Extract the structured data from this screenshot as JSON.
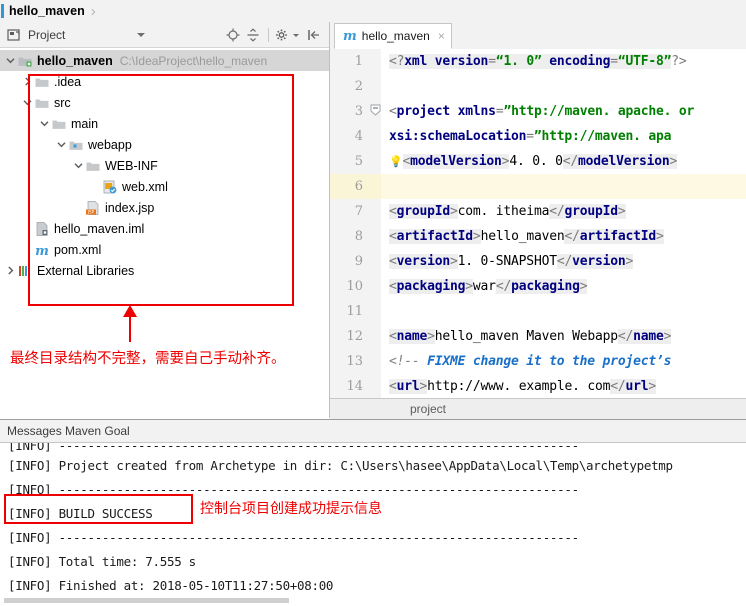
{
  "breadcrumb": {
    "project_name": "hello_maven",
    "separator": "›"
  },
  "project_panel": {
    "title": "Project",
    "icons": {
      "panel": "project-panel-icon",
      "caret": "chevron-down-icon",
      "locate": "locate-target-icon",
      "collapse_all": "collapse-all-icon",
      "settings": "gear-icon",
      "hide": "hide-panel-icon"
    },
    "tree": [
      {
        "label": "hello_maven",
        "path": "C:\\IdeaProject\\hello_maven",
        "indent": 0,
        "arrow": "expanded",
        "icon": "module-icon",
        "bold": true,
        "selected": true
      },
      {
        "label": ".idea",
        "path": "",
        "indent": 1,
        "arrow": "collapsed",
        "icon": "folder-icon",
        "bold": false,
        "selected": false
      },
      {
        "label": "src",
        "path": "",
        "indent": 1,
        "arrow": "expanded",
        "icon": "folder-icon",
        "bold": false,
        "selected": false
      },
      {
        "label": "main",
        "path": "",
        "indent": 2,
        "arrow": "expanded",
        "icon": "folder-icon",
        "bold": false,
        "selected": false
      },
      {
        "label": "webapp",
        "path": "",
        "indent": 3,
        "arrow": "expanded",
        "icon": "source-folder-icon",
        "bold": false,
        "selected": false
      },
      {
        "label": "WEB-INF",
        "path": "",
        "indent": 4,
        "arrow": "expanded",
        "icon": "folder-icon",
        "bold": false,
        "selected": false
      },
      {
        "label": "web.xml",
        "path": "",
        "indent": 5,
        "arrow": "none",
        "icon": "xml-file-icon",
        "bold": false,
        "selected": false
      },
      {
        "label": "index.jsp",
        "path": "",
        "indent": 4,
        "arrow": "none",
        "icon": "jsp-file-icon",
        "bold": false,
        "selected": false
      },
      {
        "label": "hello_maven.iml",
        "path": "",
        "indent": 1,
        "arrow": "none",
        "icon": "iml-file-icon",
        "bold": false,
        "selected": false
      },
      {
        "label": "pom.xml",
        "path": "",
        "indent": 1,
        "arrow": "none",
        "icon": "maven-pom-icon",
        "bold": false,
        "selected": false
      },
      {
        "label": "External Libraries",
        "path": "",
        "indent": 0,
        "arrow": "collapsed",
        "icon": "libraries-icon",
        "bold": false,
        "selected": false
      }
    ],
    "annotation": "最终目录结构不完整，需要自己手动补齐。"
  },
  "editor": {
    "tab": {
      "label": "hello_maven",
      "icon_letter": "m",
      "close": "×"
    },
    "status_element": "project",
    "current_line": 6,
    "lines": [
      {
        "n": 1,
        "segments": [
          {
            "t": "<?",
            "c": "br",
            "bg": true
          },
          {
            "t": "xml",
            "c": "tg",
            "bg": true
          },
          {
            "t": " ",
            "c": "tx",
            "bg": true
          },
          {
            "t": "version",
            "c": "at",
            "bg": true
          },
          {
            "t": "=",
            "c": "br",
            "bg": true
          },
          {
            "t": "“1. 0”",
            "c": "st",
            "bg": true
          },
          {
            "t": " ",
            "c": "tx",
            "bg": true
          },
          {
            "t": "encoding",
            "c": "at",
            "bg": true
          },
          {
            "t": "=",
            "c": "br",
            "bg": true
          },
          {
            "t": "“UTF-8”",
            "c": "st",
            "bg": true
          },
          {
            "t": "?>",
            "c": "br",
            "bg": false
          }
        ]
      },
      {
        "n": 2,
        "segments": []
      },
      {
        "n": 3,
        "fold": true,
        "segments": [
          {
            "t": "<",
            "c": "br",
            "bg": false
          },
          {
            "t": "project",
            "c": "tg",
            "bg": false
          },
          {
            "t": " ",
            "c": "tx",
            "bg": false
          },
          {
            "t": "xmlns",
            "c": "at",
            "bg": false
          },
          {
            "t": "=",
            "c": "br",
            "bg": false
          },
          {
            "t": "”http://maven. apache. or",
            "c": "st",
            "bg": false
          }
        ]
      },
      {
        "n": 4,
        "segments": [
          {
            "t": "  ",
            "c": "tx",
            "bg": false
          },
          {
            "t": "xsi:schemaLocation",
            "c": "at",
            "bg": false
          },
          {
            "t": "=",
            "c": "br",
            "bg": false
          },
          {
            "t": "”http://maven. apa",
            "c": "st",
            "bg": false
          }
        ]
      },
      {
        "n": 5,
        "bulb": true,
        "segments": [
          {
            "t": "<",
            "c": "br",
            "bg": true
          },
          {
            "t": "modelVersion",
            "c": "tg",
            "bg": true
          },
          {
            "t": ">",
            "c": "br",
            "bg": true
          },
          {
            "t": "4. 0. 0",
            "c": "tx",
            "bg": false
          },
          {
            "t": "</",
            "c": "br",
            "bg": true
          },
          {
            "t": "modelVersion",
            "c": "tg",
            "bg": true
          },
          {
            "t": ">",
            "c": "br",
            "bg": true
          }
        ]
      },
      {
        "n": 6,
        "segments": []
      },
      {
        "n": 7,
        "segments": [
          {
            "t": "  ",
            "c": "tx",
            "bg": false
          },
          {
            "t": "<",
            "c": "br",
            "bg": true
          },
          {
            "t": "groupId",
            "c": "tg",
            "bg": true
          },
          {
            "t": ">",
            "c": "br",
            "bg": true
          },
          {
            "t": "com. itheima",
            "c": "tx",
            "bg": false
          },
          {
            "t": "</",
            "c": "br",
            "bg": true
          },
          {
            "t": "groupId",
            "c": "tg",
            "bg": true
          },
          {
            "t": ">",
            "c": "br",
            "bg": true
          }
        ]
      },
      {
        "n": 8,
        "segments": [
          {
            "t": "  ",
            "c": "tx",
            "bg": false
          },
          {
            "t": "<",
            "c": "br",
            "bg": true
          },
          {
            "t": "artifactId",
            "c": "tg",
            "bg": true
          },
          {
            "t": ">",
            "c": "br",
            "bg": true
          },
          {
            "t": "hello_maven",
            "c": "tx",
            "bg": false
          },
          {
            "t": "</",
            "c": "br",
            "bg": true
          },
          {
            "t": "artifactId",
            "c": "tg",
            "bg": true
          },
          {
            "t": ">",
            "c": "br",
            "bg": true
          }
        ]
      },
      {
        "n": 9,
        "segments": [
          {
            "t": "  ",
            "c": "tx",
            "bg": false
          },
          {
            "t": "<",
            "c": "br",
            "bg": true
          },
          {
            "t": "version",
            "c": "tg",
            "bg": true
          },
          {
            "t": ">",
            "c": "br",
            "bg": true
          },
          {
            "t": "1. 0-SNAPSHOT",
            "c": "tx",
            "bg": false
          },
          {
            "t": "</",
            "c": "br",
            "bg": true
          },
          {
            "t": "version",
            "c": "tg",
            "bg": true
          },
          {
            "t": ">",
            "c": "br",
            "bg": true
          }
        ]
      },
      {
        "n": 10,
        "segments": [
          {
            "t": "  ",
            "c": "tx",
            "bg": false
          },
          {
            "t": "<",
            "c": "br",
            "bg": true
          },
          {
            "t": "packaging",
            "c": "tg",
            "bg": true
          },
          {
            "t": ">",
            "c": "br",
            "bg": true
          },
          {
            "t": "war",
            "c": "tx",
            "bg": false
          },
          {
            "t": "</",
            "c": "br",
            "bg": true
          },
          {
            "t": "packaging",
            "c": "tg",
            "bg": true
          },
          {
            "t": ">",
            "c": "br",
            "bg": true
          }
        ]
      },
      {
        "n": 11,
        "segments": []
      },
      {
        "n": 12,
        "segments": [
          {
            "t": "  ",
            "c": "tx",
            "bg": false
          },
          {
            "t": "<",
            "c": "br",
            "bg": true
          },
          {
            "t": "name",
            "c": "tg",
            "bg": true
          },
          {
            "t": ">",
            "c": "br",
            "bg": true
          },
          {
            "t": "hello_maven Maven Webapp",
            "c": "tx",
            "bg": false
          },
          {
            "t": "</",
            "c": "br",
            "bg": true
          },
          {
            "t": "name",
            "c": "tg",
            "bg": true
          },
          {
            "t": ">",
            "c": "br",
            "bg": true
          }
        ]
      },
      {
        "n": 13,
        "segments": [
          {
            "t": "  ",
            "c": "tx",
            "bg": false
          },
          {
            "t": "<!-- ",
            "c": "cm",
            "bg": false
          },
          {
            "t": "FIXME",
            "c": "fixme",
            "bg": false
          },
          {
            "t": " change it to the project’s",
            "c": "fixme",
            "bg": false
          }
        ]
      },
      {
        "n": 14,
        "segments": [
          {
            "t": "  ",
            "c": "tx",
            "bg": false
          },
          {
            "t": "<",
            "c": "br",
            "bg": true
          },
          {
            "t": "url",
            "c": "tg",
            "bg": true
          },
          {
            "t": ">",
            "c": "br",
            "bg": true
          },
          {
            "t": "http://www. example. com",
            "c": "tx",
            "bg": false
          },
          {
            "t": "</",
            "c": "br",
            "bg": true
          },
          {
            "t": "url",
            "c": "tg",
            "bg": true
          },
          {
            "t": ">",
            "c": "br",
            "bg": true
          }
        ]
      }
    ]
  },
  "console": {
    "title": "Messages Maven Goal",
    "lines": [
      {
        "text": "[INFO] ------------------------------------------------------------------------",
        "clip": true
      },
      {
        "text": "[INFO] Project created from Archetype in dir: C:\\Users\\hasee\\AppData\\Local\\Temp\\archetypetmp",
        "clip": false
      },
      {
        "text": "[INFO] ------------------------------------------------------------------------",
        "clip": false
      },
      {
        "text": "[INFO] BUILD SUCCESS",
        "clip": false
      },
      {
        "text": "[INFO] ------------------------------------------------------------------------",
        "clip": false
      },
      {
        "text": "[INFO] Total time: 7.555 s",
        "clip": false
      },
      {
        "text": "[INFO] Finished at: 2018-05-10T11:27:50+08:00",
        "clip": false
      }
    ],
    "annotation": "控制台项目创建成功提示信息"
  },
  "colors": {
    "annotation_red": "#ee0000",
    "tag_blue": "#000080",
    "string_green": "#008000",
    "accent_blue": "#2d9ad1",
    "current_line": "#fdf9e3"
  }
}
